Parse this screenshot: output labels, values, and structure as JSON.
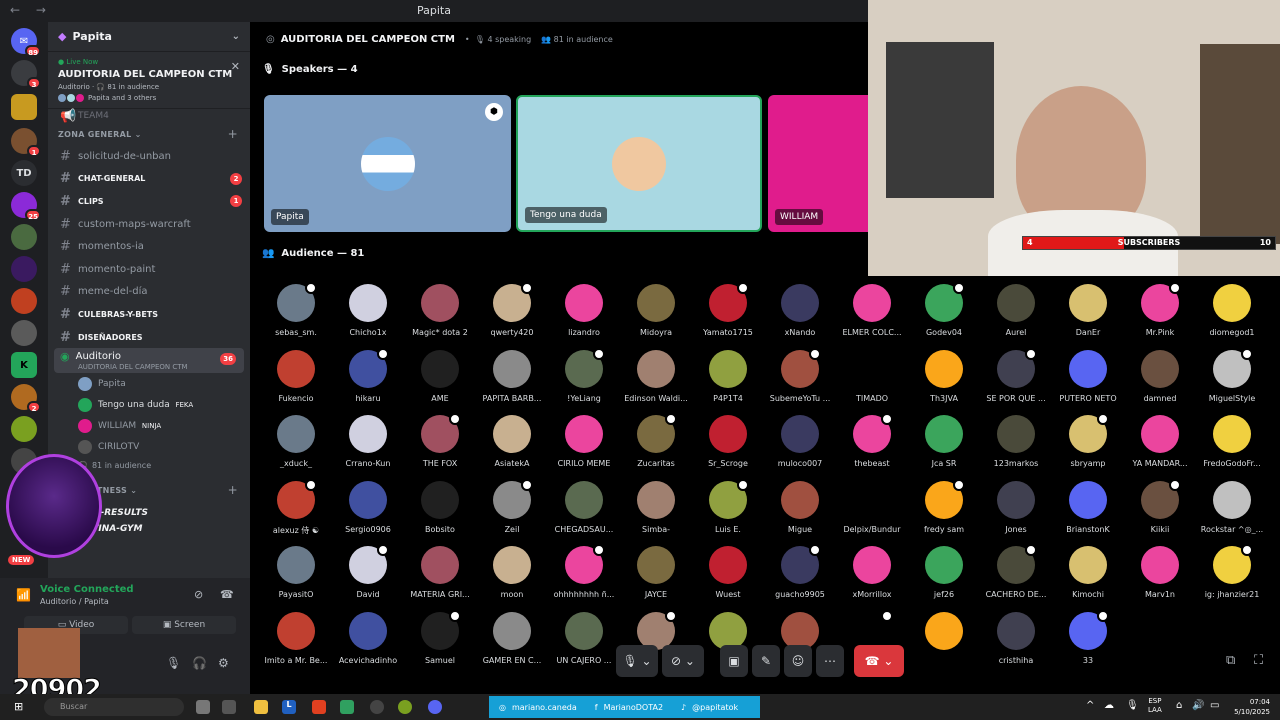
{
  "window": {
    "title": "Papita"
  },
  "server": {
    "name": "Papita"
  },
  "live": {
    "label": "Live Now",
    "title": "AUDITORIA DEL CAMPEON CTM",
    "sub": "Auditorio · 🎧 81 in audience",
    "members": "Papita and 3 others"
  },
  "channels": {
    "team_partial": "TEAM4",
    "zona_general": "ZONA GENERAL",
    "list": [
      {
        "name": "solicitud-de-unban",
        "bold": false,
        "badge": ""
      },
      {
        "name": "CHAT-GENERAL",
        "bold": true,
        "badge": "2"
      },
      {
        "name": "CLIPS",
        "bold": true,
        "badge": "1"
      },
      {
        "name": "custom-maps-warcraft",
        "bold": false,
        "badge": ""
      },
      {
        "name": "momentos-ia",
        "bold": false,
        "badge": ""
      },
      {
        "name": "momento-paint",
        "bold": false,
        "badge": ""
      },
      {
        "name": "meme-del-día",
        "bold": false,
        "badge": ""
      },
      {
        "name": "CULEBRAS-Y-BETS",
        "bold": true,
        "badge": ""
      },
      {
        "name": "DISEÑADORES",
        "bold": true,
        "badge": ""
      }
    ],
    "voice": {
      "name": "Auditorio",
      "sub": "AUDITORIA DEL CAMPEON CTM",
      "badge": "36"
    },
    "voice_users": [
      "Papita",
      "Tengo una duda",
      "WILLIAM",
      "CIRILOTV"
    ],
    "voice_user_tags": [
      "",
      "FEKA",
      "NINJA",
      ""
    ],
    "audience_note": "81 in audience",
    "zona_fitness": "ZONA FITNESS",
    "gym": "GYM-RESULTS",
    "rutina": "RUTINA-GYM"
  },
  "rail": {
    "td": "TD",
    "badges": [
      "89",
      "3",
      "",
      "1",
      "",
      "25",
      "",
      "",
      "",
      "",
      "",
      "2",
      "",
      "",
      "",
      ""
    ],
    "new": "NEW"
  },
  "userpanel": {
    "title": "Voice Connected",
    "sub": "Auditorio / Papita",
    "video": "Video",
    "screen": "Screen",
    "counter": "20902"
  },
  "stage": {
    "title": "AUDITORIA DEL CAMPEON CTM",
    "speaking": "4 speaking",
    "audience": "81 in audience",
    "speakers_label": "Speakers — 4",
    "audience_label": "Audience — 81",
    "speakers": [
      "Papita",
      "Tengo una duda",
      "WILLIAM"
    ]
  },
  "audience": [
    "sebas_sm.",
    "Chicho1x",
    "Magic* dota 2",
    "qwerty420",
    "lizandro",
    "Midoyra",
    "Yamato1715",
    "xNando",
    "ELMER COLC...",
    "Godev04",
    "Aurel",
    "DanEr",
    "Mr.Pink",
    "diomegod1",
    "Fukencio",
    "hikaru",
    "AME",
    "PAPITA BARB...",
    "!YeLiang",
    "Edinson Waldi...",
    "P4P1T4",
    "SubemeYoTu ...",
    "TIMADO",
    "Th3JVA",
    "SE POR QUE ...",
    "PUTERO NETO",
    "damned",
    "MiguelStyle",
    "_xduck_",
    "Crrano-Kun",
    "THE FOX",
    "AsiatekA",
    "CIRILO MEME",
    "Zucaritas",
    "Sr_Scroge",
    "muloco007",
    "thebeast",
    "Jca SR",
    "123markos",
    "sbryamp",
    "YA MANDAR...",
    "FredoGodoFr...",
    "alexuz 侍 ☯",
    "Sergio0906",
    "Bobsito",
    "Zeil",
    "CHEGADSAU...",
    "Simba-",
    "Luis E.",
    "Migue",
    "Delpix/Bundur",
    "fredy sam",
    "Jones",
    "BrianstonK",
    "Kiikii",
    "Rockstar ^◎_...",
    "PayasitO",
    "David",
    "MATERIA GRI...",
    "moon",
    "ohhhhhhhh ñ...",
    "JAYCE",
    "Wuest",
    "guacho9905",
    "xMorrillox",
    "jef26",
    "CACHERO DE...",
    "Kimochi",
    "Marv1n",
    "ig: jhanzier21",
    "Imito a Mr. Be...",
    "Acevichadinho",
    "Samuel",
    "GAMER EN C...",
    "UN CAJERO ...",
    "",
    "",
    "",
    "",
    "",
    "cristhiha",
    "33",
    "",
    ""
  ],
  "webcam": {
    "subs_label": "SUBSCRIBERS",
    "subs_current": "4",
    "subs_goal": "10",
    "subs_fraction": 0.4
  },
  "taskbar": {
    "search": "Buscar",
    "social": [
      "mariano.caneda",
      "MarianoDOTA2",
      "@papitatok"
    ],
    "lang": "ESP",
    "lang2": "LAA",
    "time": "07:04",
    "date": "5/10/2025"
  },
  "colors": {
    "accent": "#5865f2",
    "online": "#23a55a",
    "danger": "#da373c",
    "speaker_blue": "#7f9fc4",
    "speaker_teal": "#a9d8e2",
    "speaker_pink": "#e01c8c"
  }
}
